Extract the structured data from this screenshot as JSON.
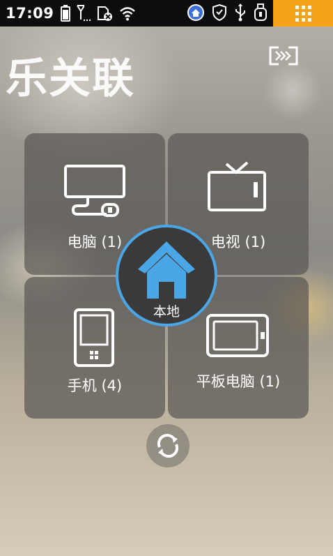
{
  "status_bar": {
    "time": "17:09"
  },
  "app": {
    "title": "乐关联"
  },
  "tiles": [
    {
      "label": "电脑 (1)",
      "icon": "monitor-icon"
    },
    {
      "label": "电视 (1)",
      "icon": "tv-icon"
    },
    {
      "label": "手机 (4)",
      "icon": "phone-icon"
    },
    {
      "label": "平板电脑 (1)",
      "icon": "tablet-icon"
    }
  ],
  "home": {
    "label": "本地",
    "accent_color": "#4ba6e6"
  },
  "colors": {
    "menu_button": "#f4a21a",
    "status_bar": "#0d0d0d"
  }
}
